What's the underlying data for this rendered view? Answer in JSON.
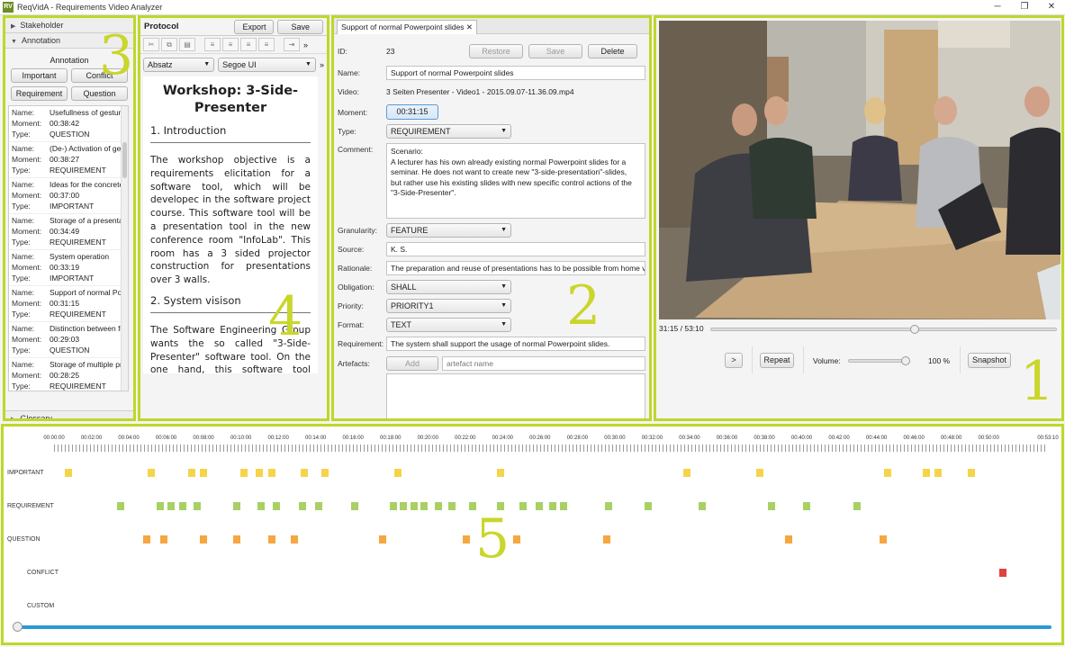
{
  "window": {
    "title": "ReqVidA - Requirements Video Analyzer",
    "minimize": "─",
    "restore": "❐",
    "close": "✕"
  },
  "panel_numbers": {
    "p1": "1",
    "p2": "2",
    "p3": "3",
    "p4": "4",
    "p5": "5"
  },
  "left": {
    "stakeholder": "Stakeholder",
    "annotation": "Annotation",
    "glossary": "Glossary",
    "annotation_title": "Annotation",
    "buttons": [
      "Important",
      "Conflict",
      "Requirement",
      "Question"
    ],
    "labels": {
      "name": "Name:",
      "moment": "Moment:",
      "type": "Type:"
    },
    "items": [
      {
        "name": "Usefullness of gesture",
        "moment": "00:38:42",
        "type": "QUESTION"
      },
      {
        "name": "(De-) Activation of ges",
        "moment": "00:38:27",
        "type": "REQUIREMENT"
      },
      {
        "name": "Ideas for the concrete",
        "moment": "00:37:00",
        "type": "IMPORTANT"
      },
      {
        "name": "Storage of a presentat",
        "moment": "00:34:49",
        "type": "REQUIREMENT"
      },
      {
        "name": "System operation",
        "moment": "00:33:19",
        "type": "IMPORTANT"
      },
      {
        "name": "Support of normal Po",
        "moment": "00:31:15",
        "type": "REQUIREMENT"
      },
      {
        "name": "Distinction between fo",
        "moment": "00:29:03",
        "type": "QUESTION"
      },
      {
        "name": "Storage of multiple pr",
        "moment": "00:28:25",
        "type": "REQUIREMENT"
      }
    ]
  },
  "protocol": {
    "label": "Protocol",
    "export": "Export",
    "save": "Save",
    "style_select": "Absatz",
    "font_select": "Segoe UI",
    "more": "»",
    "title": "Workshop: 3-Side-Presenter",
    "h1": "1. Introduction",
    "p1": "The workshop objective is a requirements elicitation for a software tool, which will be developec in the software project course. This software tool will be a presentation tool in the new conference room \"InfoLab\". This room has a 3 sided projector construction for presentations over 3 walls.",
    "h2": "2. System visison",
    "p2": "The Software Engineering Group wants the so called \"3-Side-Presenter\" software tool. On the one hand, this software tool serves to create slide presentations over the"
  },
  "detail": {
    "tab": "Support of normal Powerpoint slides",
    "tab_close": "✕",
    "restore": "Restore",
    "save": "Save",
    "delete": "Delete",
    "labels": {
      "id": "ID:",
      "name": "Name:",
      "video": "Video:",
      "moment": "Moment:",
      "type": "Type:",
      "comment": "Comment:",
      "granularity": "Granularity:",
      "source": "Source:",
      "rationale": "Rationale:",
      "obligation": "Obligation:",
      "priority": "Priority:",
      "format": "Format:",
      "requirement": "Requirement:",
      "artefacts": "Artefacts:"
    },
    "id": "23",
    "name": "Support of normal Powerpoint slides",
    "video": "3 Seiten Presenter - Video1 - 2015.09.07-11.36.09.mp4",
    "moment": "00:31:15",
    "type": "REQUIREMENT",
    "comment": [
      "Scenario:",
      "A lecturer has his own already existing normal Powerpoint slides for a",
      "seminar.  He does not want to create new \"3-side-presentation\"-slides,",
      "but rather use his existing slides with new specific control actions of the",
      "\"3-Side-Presenter\"."
    ],
    "granularity": "FEATURE",
    "source": "K. S.",
    "rationale": "The preparation and reuse of presentations has to be possible from home v",
    "obligation": "SHALL",
    "priority": "PRIORITY1",
    "format": "TEXT",
    "requirement": "The system shall support the usage of normal Powerpoint slides.",
    "add": "Add",
    "artefact_placeholder": "artefact name"
  },
  "player": {
    "time": "31:15 / 53:10",
    "progress": 0.588,
    "play": ">",
    "repeat": "Repeat",
    "volume_label": "Volume:",
    "volume": "100 %",
    "volume_level": 1.0,
    "snapshot": "Snapshot"
  },
  "timeline": {
    "ticks": [
      "00:00:00",
      "00:02:00",
      "00:04:00",
      "00:06:00",
      "00:08:00",
      "00:10:00",
      "00:12:00",
      "00:14:00",
      "00:16:00",
      "00:18:00",
      "00:20:00",
      "00:22:00",
      "00:24:00",
      "00:26:00",
      "00:28:00",
      "00:30:00",
      "00:32:00",
      "00:34:00",
      "00:36:00",
      "00:38:00",
      "00:40:00",
      "00:42:00",
      "00:44:00",
      "00:46:00",
      "00:48:00",
      "00:50:00",
      "00:53:10"
    ],
    "rows": [
      "IMPORTANT",
      "REQUIREMENT",
      "QUESTION",
      "CONFLICT",
      "CUSTOM"
    ],
    "colors": {
      "IMPORTANT": "#f5d44a",
      "REQUIREMENT": "#a8d065",
      "QUESTION": "#f5a742",
      "CONFLICT": "#e04040"
    },
    "duration_min": 53.17,
    "events": {
      "IMPORTANT": [
        0.2,
        4.6,
        6.8,
        7.4,
        9.6,
        10.4,
        11.1,
        12.8,
        13.9,
        17.8,
        23.3,
        33.3,
        37.2,
        44.0,
        46.1,
        46.7,
        48.5
      ],
      "REQUIREMENT": [
        3.0,
        5.1,
        5.7,
        6.3,
        7.1,
        9.2,
        10.5,
        11.3,
        12.7,
        13.6,
        15.5,
        17.6,
        18.1,
        18.7,
        19.2,
        20.0,
        20.7,
        21.8,
        23.3,
        24.5,
        25.4,
        26.1,
        26.7,
        29.1,
        31.2,
        34.1,
        37.8,
        39.7,
        42.4
      ],
      "QUESTION": [
        4.4,
        5.3,
        7.4,
        9.2,
        11.1,
        12.3,
        17.0,
        21.5,
        24.2,
        29.0,
        38.7,
        43.8
      ],
      "CONFLICT": [
        50.2
      ],
      "CUSTOM": []
    },
    "playhead": 0.0
  }
}
